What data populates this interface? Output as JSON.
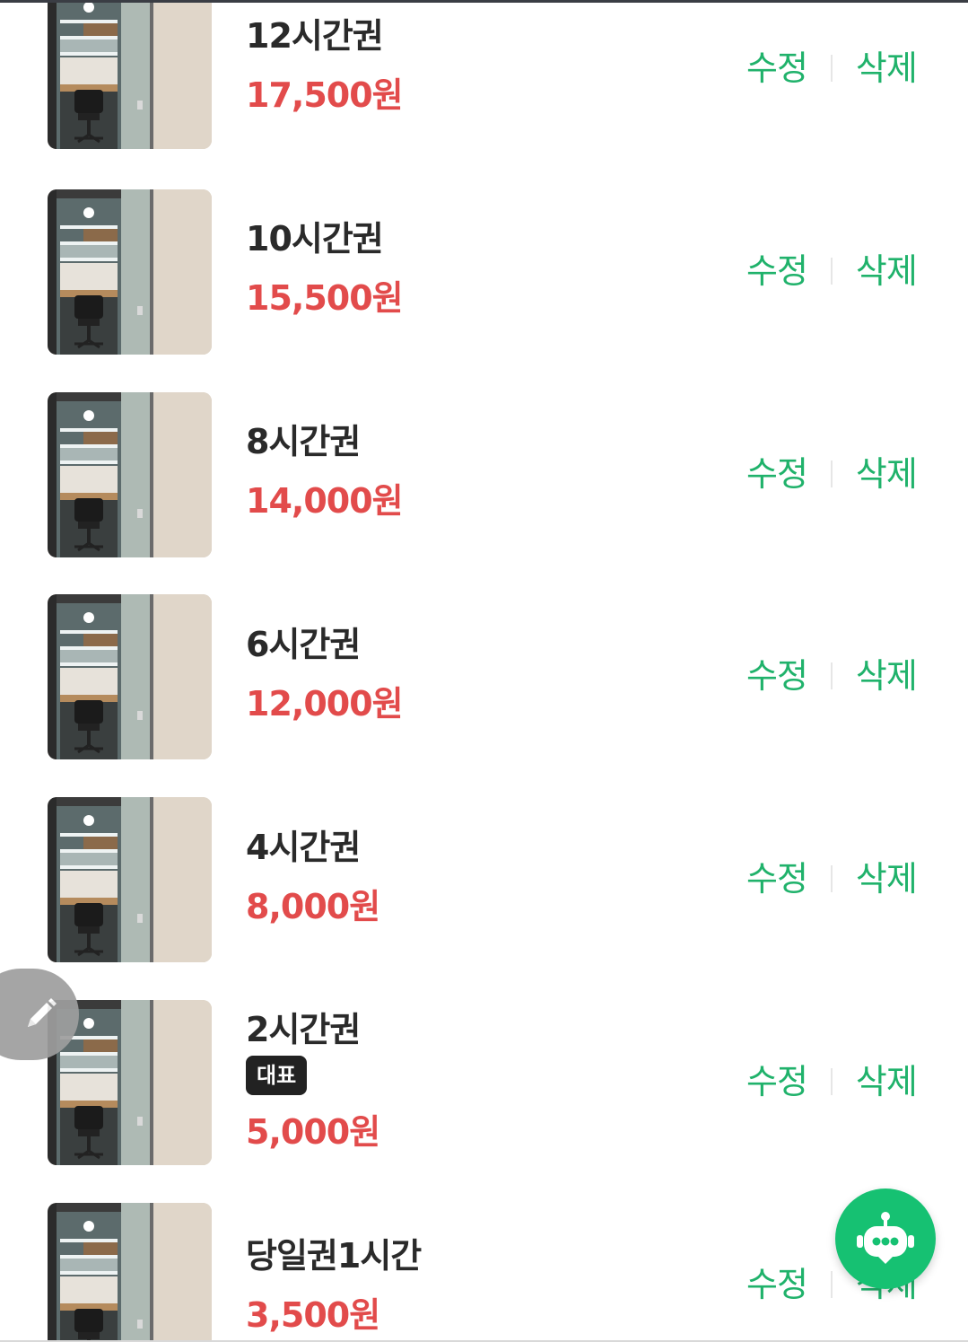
{
  "products": [
    {
      "name": "12시간권",
      "price": "17,500원",
      "badge": "",
      "edit_label": "수정",
      "delete_label": "삭제",
      "thumbnail": "study-booth-photo"
    },
    {
      "name": "10시간권",
      "price": "15,500원",
      "badge": "",
      "edit_label": "수정",
      "delete_label": "삭제",
      "thumbnail": "study-booth-photo"
    },
    {
      "name": "8시간권",
      "price": "14,000원",
      "badge": "",
      "edit_label": "수정",
      "delete_label": "삭제",
      "thumbnail": "study-booth-photo"
    },
    {
      "name": "6시간권",
      "price": "12,000원",
      "badge": "",
      "edit_label": "수정",
      "delete_label": "삭제",
      "thumbnail": "study-booth-photo"
    },
    {
      "name": "4시간권",
      "price": "8,000원",
      "badge": "",
      "edit_label": "수정",
      "delete_label": "삭제",
      "thumbnail": "study-booth-photo"
    },
    {
      "name": "2시간권",
      "price": "5,000원",
      "badge": "대표",
      "edit_label": "수정",
      "delete_label": "삭제",
      "thumbnail": "study-booth-photo"
    },
    {
      "name": "당일권1시간",
      "price": "3,500원",
      "badge": "",
      "edit_label": "수정",
      "delete_label": "삭제",
      "thumbnail": "study-booth-photo"
    }
  ],
  "floating": {
    "edit_fab_icon": "pencil-icon",
    "chatbot_fab_icon": "robot-icon"
  },
  "colors": {
    "price": "#e24b4b",
    "action": "#20b26b",
    "badge_bg": "#222222",
    "chatbot_bg": "#16c172",
    "edit_fab_bg": "#9e9e9e"
  }
}
